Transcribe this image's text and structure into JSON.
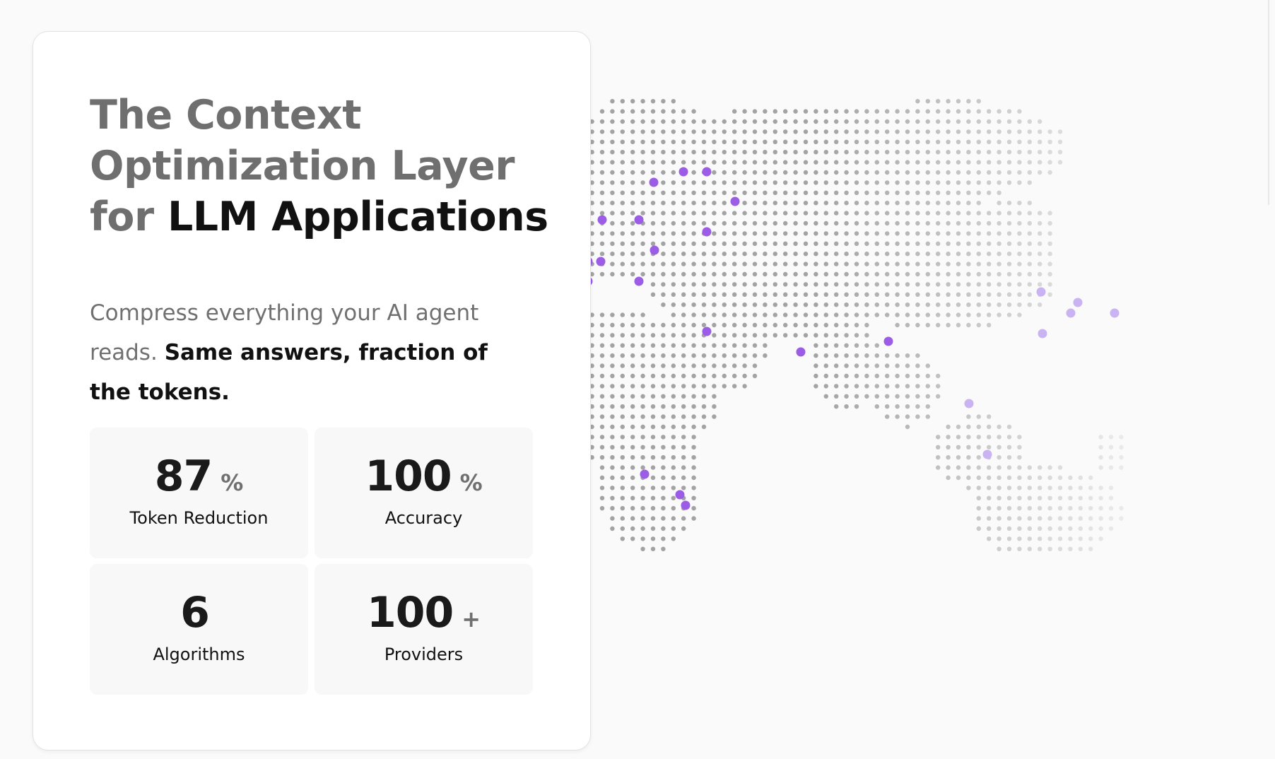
{
  "hero": {
    "headline_muted_1": "The Context",
    "headline_muted_2": "Optimization Layer",
    "headline_muted_3": "for",
    "headline_strong": "LLM Applications",
    "subtitle_muted": "Compress everything your AI agent reads.",
    "subtitle_strong": "Same answers, fraction of the tokens."
  },
  "stats": [
    {
      "value": "87",
      "unit": "%",
      "label": "Token Reduction"
    },
    {
      "value": "100",
      "unit": "%",
      "label": "Accuracy"
    },
    {
      "value": "6",
      "unit": "",
      "label": "Algorithms"
    },
    {
      "value": "100",
      "unit": "+",
      "label": "Providers"
    }
  ],
  "map": {
    "dot_color": "#a3a3a3",
    "highlight_color": "#9b5de5",
    "highlight_light_color": "#c9b3f2"
  }
}
